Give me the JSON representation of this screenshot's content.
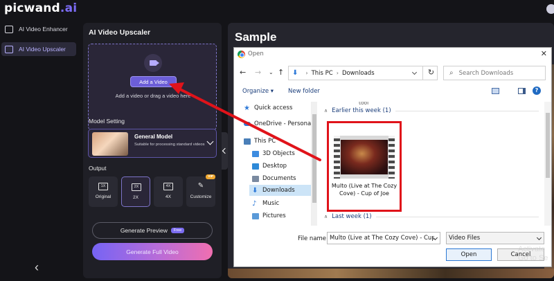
{
  "app": {
    "logo_main": "picwand",
    "logo_suffix": ".ai",
    "nav": [
      {
        "label": "AI Video Enhancer"
      },
      {
        "label": "AI Video Upscaler"
      }
    ],
    "back_glyph": "‹"
  },
  "upscaler": {
    "title": "AI Video Upscaler",
    "add_button": "Add a Video",
    "drop_text": "Add a video or drag a video here",
    "model_setting_label": "Model Setting",
    "model": {
      "name": "General Model",
      "desc": "Suitable for processing standard videos"
    },
    "output_label": "Output",
    "output_options": [
      {
        "icon": "1X",
        "label": "Original"
      },
      {
        "icon": "2X",
        "label": "2X"
      },
      {
        "icon": "4X",
        "label": "4X"
      },
      {
        "icon": "✎",
        "label": "Customize",
        "badge": "VIP"
      }
    ],
    "selected_output": "2X",
    "preview_button": "Generate Preview",
    "free_badge": "Free",
    "full_button": "Generate Full Video"
  },
  "sample": {
    "title": "Sample"
  },
  "dialog": {
    "title": "Open",
    "close": "✕",
    "path": [
      "This PC",
      "Downloads"
    ],
    "search_placeholder": "Search Downloads",
    "toolbar": {
      "organize": "Organize ▾",
      "new_folder": "New folder",
      "help": "?"
    },
    "nav_pane": [
      {
        "label": "Quick access",
        "icon": "star-icon",
        "color": "#2f7ad8"
      },
      {
        "label": "OneDrive - Persona",
        "icon": "cloud-icon",
        "color": "#2f7ad8"
      },
      {
        "label": "This PC",
        "icon": "pc-icon",
        "color": "#4a7fb8"
      },
      {
        "label": "3D Objects",
        "icon": "cube-icon",
        "color": "#3d8ce0"
      },
      {
        "label": "Desktop",
        "icon": "desktop-icon",
        "color": "#2e8ad8"
      },
      {
        "label": "Documents",
        "icon": "documents-icon",
        "color": "#7a8aa0"
      },
      {
        "label": "Downloads",
        "icon": "download-icon",
        "color": "#2f7ad8"
      },
      {
        "label": "Music",
        "icon": "music-icon",
        "color": "#2f7ad8"
      },
      {
        "label": "Pictures",
        "icon": "pictures-icon",
        "color": "#5a9ad8"
      }
    ],
    "selected_nav": "Downloads",
    "group_top_fragment": "tool",
    "groups": [
      {
        "label": "Earlier this week (1)"
      },
      {
        "label": "Last week (1)"
      }
    ],
    "file": {
      "name": "Multo (Live at The Cozy Cove) - Cup of Joe"
    },
    "file_name_label": "File name:",
    "file_name_value": "Multo (Live at The Cozy Cove) - Cup",
    "file_type": "Video Files",
    "open_button": "Open",
    "cancel_button": "Cancel"
  },
  "watermark": {
    "line1": "Activate",
    "line2": "Go to Se"
  },
  "colors": {
    "accent": "#7c6cf5",
    "annotation_red": "#e0131a"
  }
}
